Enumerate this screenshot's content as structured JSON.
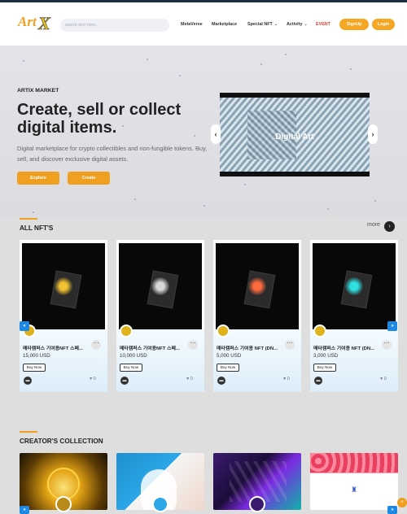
{
  "header": {
    "logo_text": "ArtX",
    "search_placeholder": "search item here...",
    "nav": [
      {
        "label": "MetaVerse"
      },
      {
        "label": "Marketplace"
      },
      {
        "label": "Special NFT",
        "icon": "chevron-down-icon"
      },
      {
        "label": "Activity",
        "icon": "chevron-down-icon"
      },
      {
        "label": "EVENT"
      }
    ],
    "signup_label": "SignUp",
    "login_label": "Login"
  },
  "hero": {
    "eyebrow": "ARTIX MARKET",
    "title": "Create, sell or collect digital items.",
    "subtitle": "Digital marketplace for crypto collectibles and non-fungible tokens. Buy, sell, and discover exclusive digital assets.",
    "explore_label": "Explore",
    "create_label": "Create",
    "slide_label": "Digital Art"
  },
  "all_nfts": {
    "title": "ALL NFT'S",
    "more_label": "more",
    "cards": [
      {
        "name": "메타캠퍼스 기여용NFT 스페...",
        "price": "15,000 USD",
        "buy_label": "Buy Now",
        "likes": "0",
        "glow": "#f2c230"
      },
      {
        "name": "메타캠퍼스 기여용NFT 스페...",
        "price": "10,000 USD",
        "buy_label": "Buy Now",
        "likes": "0",
        "glow": "#d8d8d8"
      },
      {
        "name": "메타캠퍼스 기여용 NFT (DN...",
        "price": "5,000 USD",
        "buy_label": "Buy Now",
        "likes": "0",
        "glow": "#ff6a3d"
      },
      {
        "name": "메타캠퍼스 기여용 NFT (DN...",
        "price": "3,000 USD",
        "buy_label": "Buy Now",
        "likes": "0",
        "glow": "#2fe0e0"
      }
    ]
  },
  "creators": {
    "title": "CREATOR'S COLLECTION"
  },
  "colors": {
    "accent": "#f0a020",
    "nav_blue": "#1e88e5",
    "event_red": "#e53935"
  }
}
